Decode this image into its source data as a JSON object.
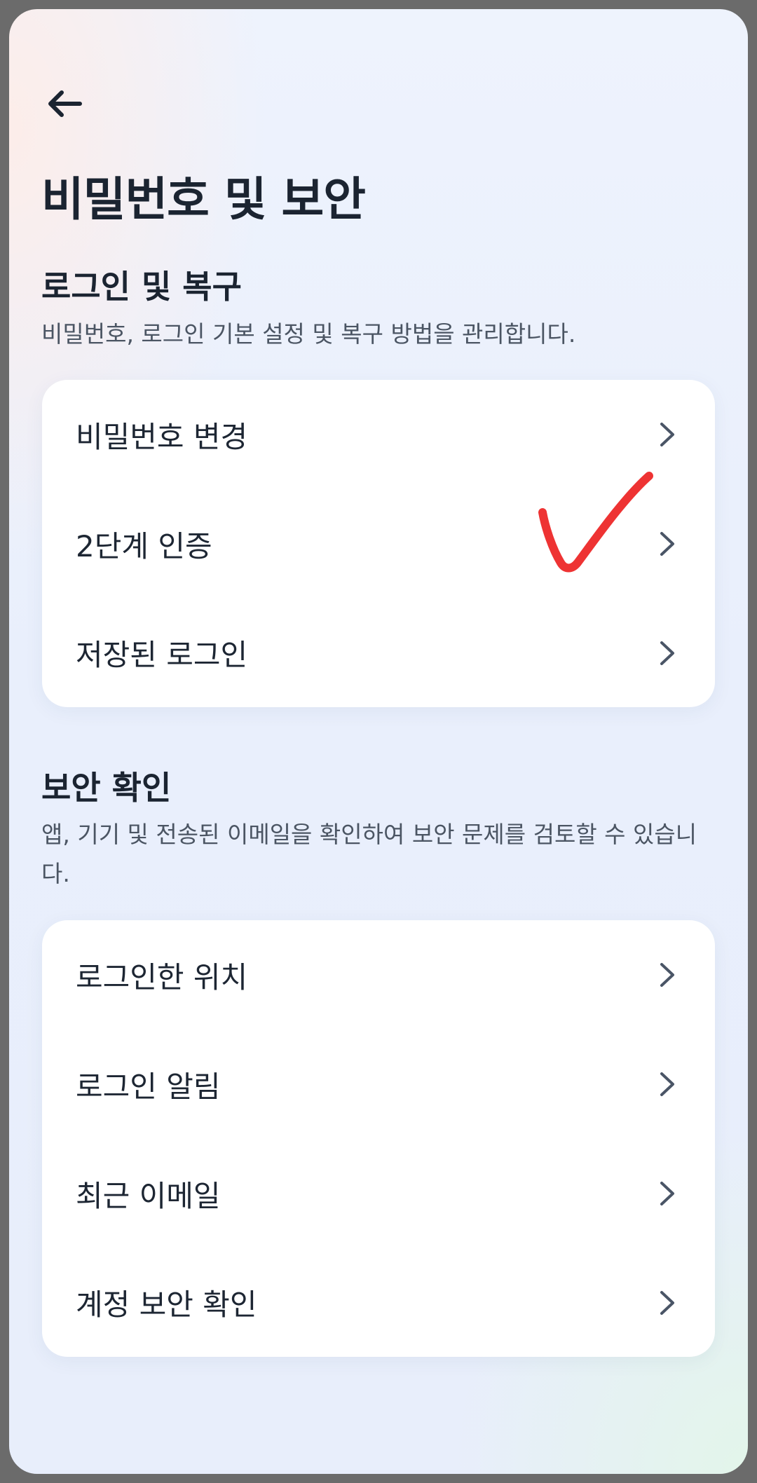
{
  "header": {
    "back_icon": "arrow-left-icon",
    "title": "비밀번호 및 보안"
  },
  "login_recovery": {
    "heading": "로그인 및 복구",
    "description": "비밀번호, 로그인 기본 설정 및 복구 방법을 관리합니다.",
    "items": [
      {
        "label": "비밀번호 변경",
        "icon": "chevron-right-icon"
      },
      {
        "label": "2단계 인증",
        "icon": "chevron-right-icon"
      },
      {
        "label": "저장된 로그인",
        "icon": "chevron-right-icon"
      }
    ]
  },
  "security_check": {
    "heading": "보안 확인",
    "description": "앱, 기기 및 전송된 이메일을 확인하여 보안 문제를 검토할 수 있습니다.",
    "items": [
      {
        "label": "로그인한 위치",
        "icon": "chevron-right-icon"
      },
      {
        "label": "로그인 알림",
        "icon": "chevron-right-icon"
      },
      {
        "label": "최근 이메일",
        "icon": "chevron-right-icon"
      },
      {
        "label": "계정 보안 확인",
        "icon": "chevron-right-icon"
      }
    ]
  },
  "annotation": {
    "icon": "red-checkmark-icon",
    "color": "#ee3333"
  },
  "colors": {
    "text_primary": "#1b2431",
    "text_secondary": "#4b5563",
    "card_background": "#ffffff",
    "chevron": "#4a5566"
  }
}
